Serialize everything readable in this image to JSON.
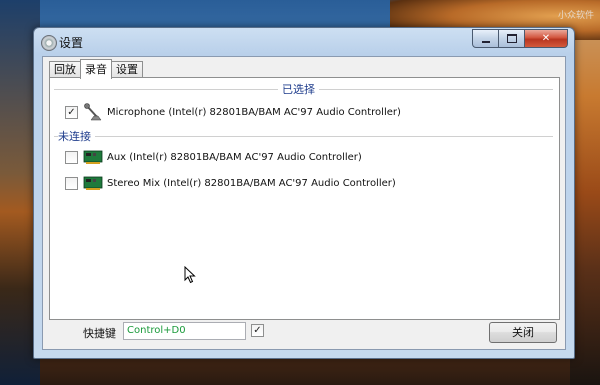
{
  "watermark": "小众软件",
  "window": {
    "title": "设置",
    "tabs": [
      {
        "label": "回放"
      },
      {
        "label": "录音"
      },
      {
        "label": "设置"
      }
    ],
    "active_tab": "录音"
  },
  "recording": {
    "selected_header": "已选择",
    "unconnected_header": "未连接",
    "selected_devices": [
      {
        "label": "Microphone (Intel(r) 82801BA/BAM AC'97 Audio Controller)",
        "checked": true,
        "icon": "microphone-icon"
      }
    ],
    "unconnected_devices": [
      {
        "label": "Aux (Intel(r) 82801BA/BAM AC'97 Audio Controller)",
        "checked": false,
        "icon": "sound-card-icon"
      },
      {
        "label": "Stereo Mix (Intel(r) 82801BA/BAM AC'97 Audio Controller)",
        "checked": false,
        "icon": "sound-card-icon"
      }
    ]
  },
  "footer": {
    "hotkey_label": "快捷键",
    "hotkey_value": "Control+D0",
    "hotkey_enabled": true,
    "close_label": "关闭"
  },
  "colors": {
    "header_text": "#1e3c8c",
    "hotkey_text": "#1a9a3a",
    "close_button_red": "#c8402a"
  }
}
